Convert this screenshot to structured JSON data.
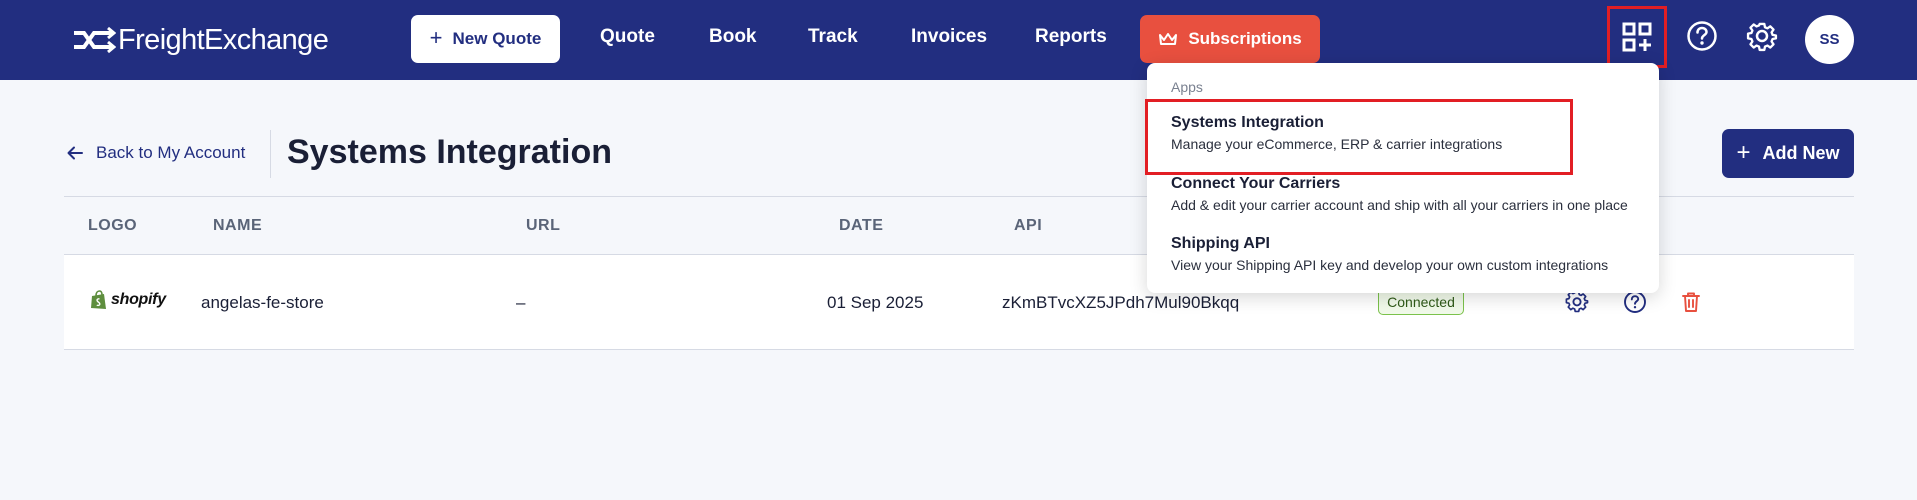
{
  "header": {
    "logo_text": "FreightExchange",
    "new_quote_label": "New Quote",
    "nav": [
      "Quote",
      "Book",
      "Track",
      "Invoices",
      "Reports"
    ],
    "subscriptions_label": "Subscriptions",
    "avatar_initials": "SS",
    "icons": [
      "apps-grid-icon",
      "help-circle-icon",
      "gear-icon"
    ]
  },
  "page": {
    "back_label": "Back to My Account",
    "title": "Systems Integration",
    "add_new_label": "Add New"
  },
  "table": {
    "columns": [
      "LOGO",
      "NAME",
      "URL",
      "DATE",
      "API"
    ],
    "rows": [
      {
        "logo_text": "shopify",
        "name": "angelas-fe-store",
        "url": "–",
        "date": "01 Sep 2025",
        "api": "zKmBTvcXZ5JPdh7Mul90Bkqq",
        "status": "Connected"
      }
    ]
  },
  "apps_menu": {
    "heading": "Apps",
    "items": [
      {
        "title": "Systems Integration",
        "subtitle": "Manage your eCommerce, ERP & carrier integrations"
      },
      {
        "title": "Connect Your Carriers",
        "subtitle": "Add & edit your carrier account and ship with all your carriers in one place"
      },
      {
        "title": "Shipping API",
        "subtitle": "View your Shipping API key and develop your own custom integrations"
      }
    ]
  },
  "colors": {
    "header_bg": "#222e80",
    "accent_red": "#e8503f",
    "highlight_border": "#e21e24",
    "status_green": "#7bc24b"
  }
}
